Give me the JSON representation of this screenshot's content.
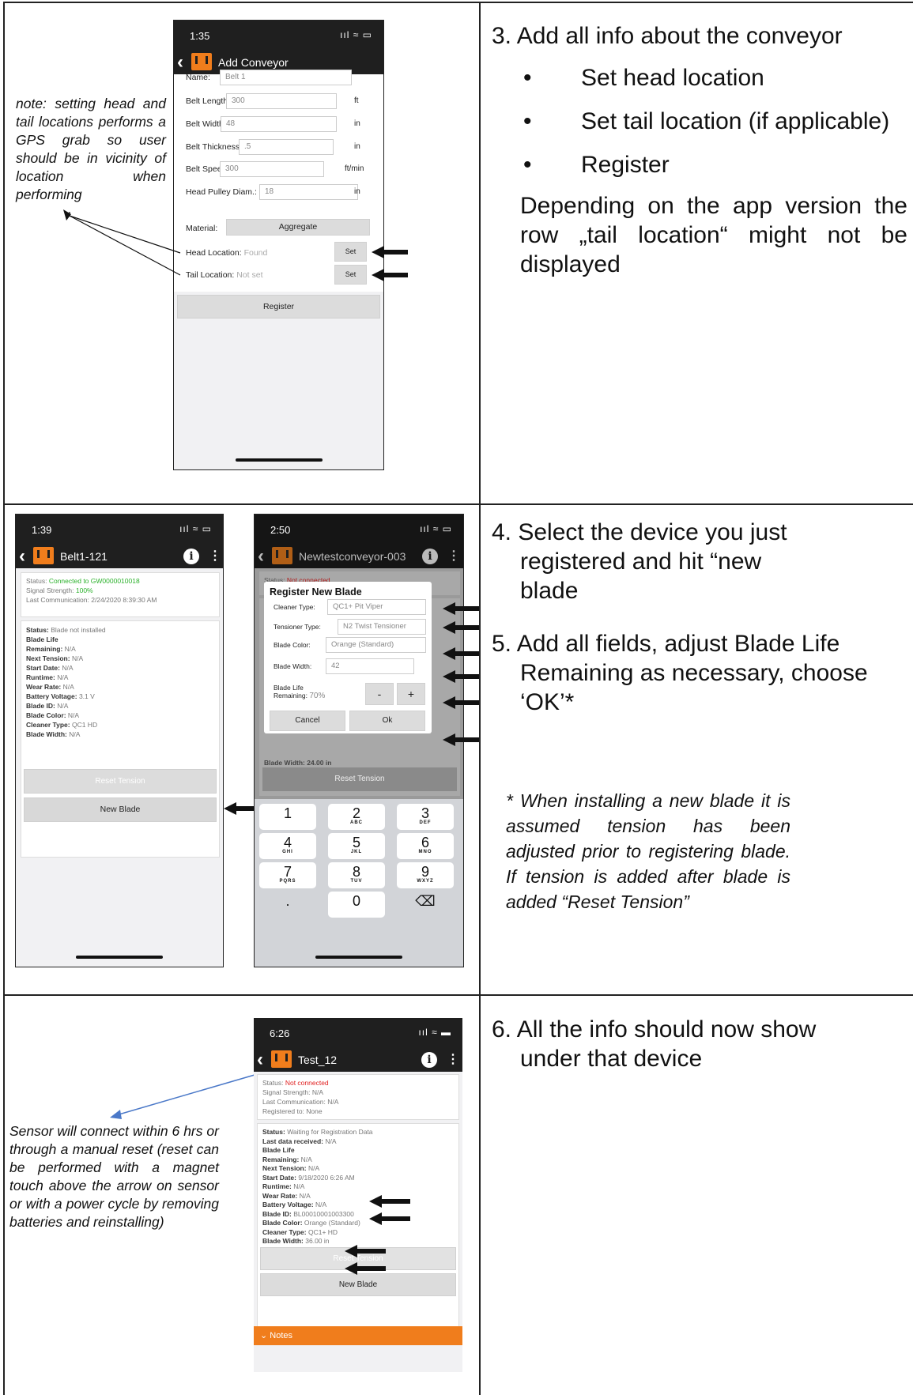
{
  "row1": {
    "instruction": "3. Add all info about the conveyor",
    "bullets": [
      "Set head location",
      "Set tail location (if applicable)",
      "Register"
    ],
    "paragraph": "Depending on the app version the row „tail location“ might not be displayed",
    "note": "note: setting head and tail locations performs a GPS grab so user should be in vicinity of location when performing",
    "phone": {
      "time": "1:35",
      "signal": "ııl ≈ ▭",
      "title": "Add Conveyor",
      "fields": [
        {
          "label": "Name:",
          "value": "Belt 1",
          "unit": ""
        },
        {
          "label": "Belt Length:",
          "value": "300",
          "unit": "ft"
        },
        {
          "label": "Belt Width:",
          "value": "48",
          "unit": "in"
        },
        {
          "label": "Belt Thickness:",
          "value": ".5",
          "unit": "in"
        },
        {
          "label": "Belt Speed:",
          "value": "300",
          "unit": "ft/min"
        },
        {
          "label": "Head Pulley Diam.:",
          "value": "18",
          "unit": "in"
        }
      ],
      "material_label": "Material:",
      "material_value": "Aggregate",
      "head_label": "Head Location:",
      "head_value": "Found",
      "tail_label": "Tail Location:",
      "tail_value": "Not set",
      "set_label": "Set",
      "register_label": "Register"
    }
  },
  "row2": {
    "instruction4": "4. Select the device you just registered and hit “new blade",
    "instruction5": "5. Add all fields, adjust Blade Life Remaining as necessary, choose ‘OK’*",
    "note": "* When installing a new blade it is assumed tension has been adjusted prior to registering blade. If tension is added after blade is added “Reset Tension”",
    "phoneA": {
      "time": "1:39",
      "signal": "ııl ≈ ▭",
      "title": "Belt1-121",
      "status_label": "Status:",
      "status_value": "Connected to GW0000010018",
      "signal_label": "Signal Strength:",
      "signal_value": "100%",
      "lastcomm_label": "Last Communication:",
      "lastcomm_value": "2/24/2020 8:39:30 AM",
      "rows": [
        {
          "label": "Status:",
          "value": "Blade not installed"
        },
        {
          "label": "Blade Life",
          "value": ""
        },
        {
          "label": "Remaining:",
          "value": "N/A"
        },
        {
          "label": "Next Tension:",
          "value": "N/A"
        },
        {
          "label": "Start Date:",
          "value": "N/A"
        },
        {
          "label": "Runtime:",
          "value": "N/A"
        },
        {
          "label": "Wear Rate:",
          "value": "N/A"
        },
        {
          "label": "Battery Voltage:",
          "value": "3.1 V"
        },
        {
          "label": "Blade ID:",
          "value": "N/A"
        },
        {
          "label": "Blade Color:",
          "value": "N/A"
        },
        {
          "label": "Cleaner Type:",
          "value": "QC1 HD"
        },
        {
          "label": "Blade Width:",
          "value": "N/A"
        }
      ],
      "reset_label": "Reset Tension",
      "newblade_label": "New Blade"
    },
    "phoneB": {
      "time": "2:50",
      "signal": "ııl ≈ ▭",
      "title": "Newtestconveyor-003",
      "status_label": "Status:",
      "status_value": "Not connected",
      "dialog_title": "Register New Blade",
      "fields": [
        {
          "label": "Cleaner Type:",
          "value": "QC1+ Pit Viper"
        },
        {
          "label": "Tensioner Type:",
          "value": "N2 Twist Tensioner"
        },
        {
          "label": "Blade Color:",
          "value": "Orange (Standard)"
        },
        {
          "label": "Blade Width:",
          "value": "42"
        }
      ],
      "life_label1": "Blade Life",
      "life_label2": "Remaining:",
      "life_value": "70%",
      "minus": "-",
      "plus": "+",
      "cancel": "Cancel",
      "ok": "Ok",
      "bg_width_row": "Blade Width: 24.00 in",
      "reset_label": "Reset Tension",
      "keys": [
        {
          "n": "1",
          "l": ""
        },
        {
          "n": "2",
          "l": "ABC"
        },
        {
          "n": "3",
          "l": "DEF"
        },
        {
          "n": "4",
          "l": "GHI"
        },
        {
          "n": "5",
          "l": "JKL"
        },
        {
          "n": "6",
          "l": "MNO"
        },
        {
          "n": "7",
          "l": "PQRS"
        },
        {
          "n": "8",
          "l": "TUV"
        },
        {
          "n": "9",
          "l": "WXYZ"
        },
        {
          "n": ".",
          "l": ""
        },
        {
          "n": "0",
          "l": ""
        },
        {
          "n": "⌫",
          "l": ""
        }
      ]
    }
  },
  "row3": {
    "instruction": "6. All the info should now show under that device",
    "note": "Sensor will connect within 6 hrs or through a manual reset (reset can be performed with a magnet touch above the arrow on sensor or with a power cycle by removing batteries and reinstalling)",
    "phone": {
      "time": "6:26",
      "signal": "ııl ≈ ▬",
      "title": "Test_12",
      "status_label": "Status:",
      "status_value": "Not connected",
      "signal_label": "Signal Strength:",
      "signal_value": "N/A",
      "lastcomm_label": "Last Communication:",
      "lastcomm_value": "N/A",
      "regto_label": "Registered to:",
      "regto_value": "None",
      "rows": [
        {
          "label": "Status:",
          "value": "Waiting for Registration Data"
        },
        {
          "label": "Last data received:",
          "value": "N/A"
        },
        {
          "label": "Blade Life",
          "value": ""
        },
        {
          "label": "Remaining:",
          "value": "N/A"
        },
        {
          "label": "Next Tension:",
          "value": "N/A"
        },
        {
          "label": "Start Date:",
          "value": "9/18/2020 6:26 AM"
        },
        {
          "label": "Runtime:",
          "value": "N/A"
        },
        {
          "label": "Wear Rate:",
          "value": "N/A"
        },
        {
          "label": "Battery Voltage:",
          "value": "N/A"
        },
        {
          "label": "Blade ID:",
          "value": "BL00010001003300"
        },
        {
          "label": "Blade Color:",
          "value": "Orange (Standard)"
        },
        {
          "label": "Cleaner Type:",
          "value": "QC1+ HD"
        },
        {
          "label": "Blade Width:",
          "value": "36.00 in"
        }
      ],
      "reset_label": "Reset Tension",
      "newblade_label": "New Blade",
      "notes_label": "Notes"
    }
  },
  "colors": {
    "orange": "#f07d1c",
    "green": "#2bb12b",
    "red": "#e02020",
    "dark": "#1f1f1f",
    "blue_arrow": "#4a78c8"
  }
}
